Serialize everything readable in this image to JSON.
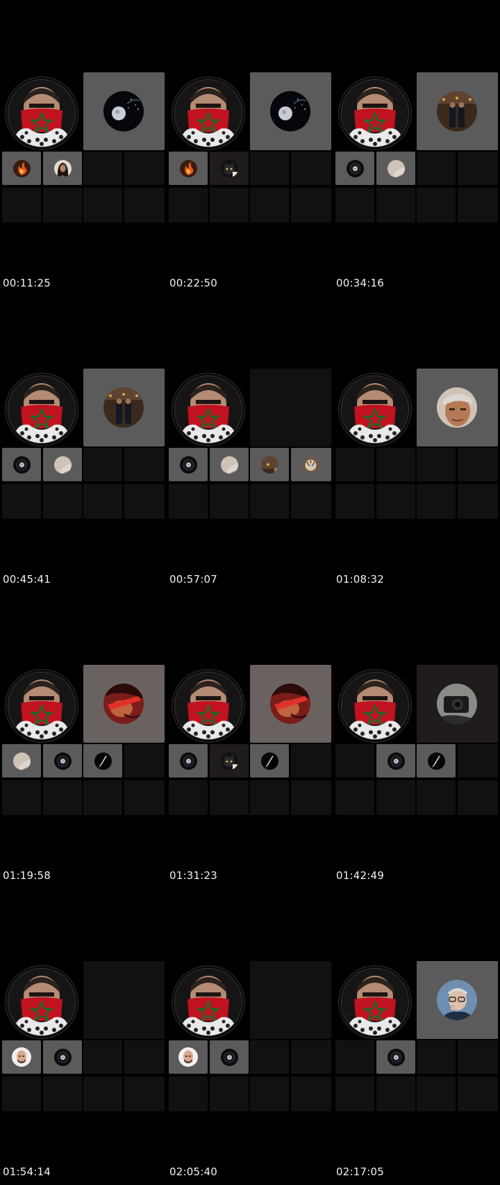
{
  "frames": [
    {
      "timestamp": "00:11:25",
      "speaker": {
        "bg": "lit",
        "avatar": "moon-dandelion"
      },
      "tiles": [
        [
          "lit",
          "fire"
        ],
        [
          "lit",
          "woman"
        ],
        [
          "off",
          ""
        ],
        [
          "off",
          ""
        ]
      ]
    },
    {
      "timestamp": "00:22:50",
      "speaker": {
        "bg": "lit",
        "avatar": "moon-dandelion"
      },
      "tiles": [
        [
          "lit",
          "fire"
        ],
        [
          "dark",
          "cat"
        ],
        [
          "off",
          ""
        ],
        [
          "off",
          ""
        ]
      ]
    },
    {
      "timestamp": "00:34:16",
      "speaker": {
        "bg": "lit",
        "avatar": "hall-figures"
      },
      "tiles": [
        [
          "lit",
          "vinyl"
        ],
        [
          "lit",
          "man-cap"
        ],
        [
          "off",
          ""
        ],
        [
          "off",
          ""
        ]
      ]
    },
    {
      "timestamp": "00:45:41",
      "speaker": {
        "bg": "lit",
        "avatar": "hall-figures"
      },
      "tiles": [
        [
          "lit",
          "vinyl"
        ],
        [
          "lit",
          "man-cap"
        ],
        [
          "off",
          ""
        ],
        [
          "off",
          ""
        ]
      ]
    },
    {
      "timestamp": "00:57:07",
      "speaker": {
        "bg": "off",
        "avatar": ""
      },
      "tiles": [
        [
          "lit",
          "vinyl"
        ],
        [
          "lit",
          "man-cap"
        ],
        [
          "lit",
          "hall-figures"
        ],
        [
          "lit",
          "tiger"
        ]
      ]
    },
    {
      "timestamp": "01:08:32",
      "speaker": {
        "bg": "lit",
        "avatar": "man-cap"
      },
      "tiles": [
        [
          "off",
          ""
        ],
        [
          "off",
          ""
        ],
        [
          "off",
          ""
        ],
        [
          "off",
          ""
        ]
      ]
    },
    {
      "timestamp": "01:19:58",
      "speaker": {
        "bg": "warm",
        "avatar": "red-cap"
      },
      "tiles": [
        [
          "lit",
          "man-cap"
        ],
        [
          "lit",
          "vinyl"
        ],
        [
          "lit",
          "pen"
        ],
        [
          "off",
          ""
        ]
      ]
    },
    {
      "timestamp": "01:31:23",
      "speaker": {
        "bg": "warm",
        "avatar": "red-cap"
      },
      "tiles": [
        [
          "lit",
          "vinyl"
        ],
        [
          "dark",
          "cat"
        ],
        [
          "lit",
          "pen"
        ],
        [
          "off",
          ""
        ]
      ]
    },
    {
      "timestamp": "01:42:49",
      "speaker": {
        "bg": "dark",
        "avatar": "camera"
      },
      "tiles": [
        [
          "off",
          ""
        ],
        [
          "lit",
          "vinyl"
        ],
        [
          "lit",
          "pen"
        ],
        [
          "off",
          ""
        ]
      ]
    },
    {
      "timestamp": "01:54:14",
      "speaker": {
        "bg": "off",
        "avatar": ""
      },
      "tiles": [
        [
          "lit",
          "bald-man"
        ],
        [
          "lit",
          "vinyl"
        ],
        [
          "off",
          ""
        ],
        [
          "off",
          ""
        ]
      ]
    },
    {
      "timestamp": "02:05:40",
      "speaker": {
        "bg": "off",
        "avatar": ""
      },
      "tiles": [
        [
          "lit",
          "bald-man"
        ],
        [
          "lit",
          "vinyl"
        ],
        [
          "off",
          ""
        ],
        [
          "off",
          ""
        ]
      ]
    },
    {
      "timestamp": "02:17:05",
      "speaker": {
        "bg": "lit",
        "avatar": "glasses-man"
      },
      "tiles": [
        [
          "off",
          ""
        ],
        [
          "lit",
          "vinyl"
        ],
        [
          "off",
          ""
        ],
        [
          "off",
          ""
        ]
      ]
    }
  ],
  "colors": {
    "background": "#000000",
    "tile_lit": "#5b5b5b",
    "tile_off": "#111111",
    "text": "#f2f2f2",
    "flag_red": "#c1121f",
    "flag_green": "#1b6b2d"
  }
}
